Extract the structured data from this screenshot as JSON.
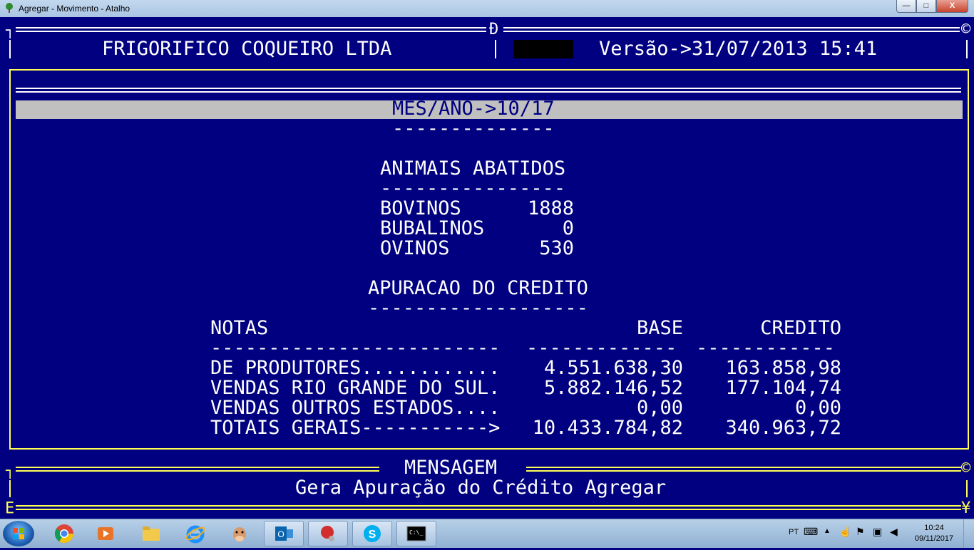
{
  "window": {
    "title": "Agregar - Movimento - Atalho",
    "buttons": [
      "—",
      "□",
      "X"
    ]
  },
  "header": {
    "company": "FRIGORIFICO COQUEIRO LTDA",
    "version": "Versão->31/07/2013 15:41",
    "corner_mark": "Ð"
  },
  "report": {
    "period": "MES/ANO->10/17",
    "period_underline": "--------------",
    "animals": {
      "title": "ANIMAIS ABATIDOS",
      "underline": "----------------",
      "rows": [
        {
          "label": "BOVINOS",
          "value": "1888"
        },
        {
          "label": "BUBALINOS",
          "value": "0"
        },
        {
          "label": "OVINOS",
          "value": "530"
        }
      ]
    },
    "credit": {
      "title": "APURACAO DO CREDITO",
      "underline": "-------------------",
      "columns": [
        "NOTAS",
        "BASE",
        "CREDITO"
      ],
      "dashes": [
        "-------------------------",
        "-------------",
        "------------"
      ],
      "rows": [
        {
          "label": "DE PRODUTORES............",
          "base": "4.551.638,30",
          "credito": "163.858,98"
        },
        {
          "label": "VENDAS RIO GRANDE DO SUL.",
          "base": "5.882.146,52",
          "credito": "177.104,74"
        },
        {
          "label": "VENDAS OUTROS ESTADOS....",
          "base": "0,00",
          "credito": "0,00"
        },
        {
          "label": "TOTAIS GERAIS----------->",
          "base": "10.433.784,82",
          "credito": "340.963,72"
        }
      ]
    }
  },
  "message": {
    "title": "MENSAGEM",
    "text": "Gera Apuração do Crédito Agregar"
  },
  "frame_glyphs": {
    "tl": "┐",
    "tr": "©",
    "ml": "┐",
    "mr": "©",
    "bl": "Ε",
    "br": "¥"
  },
  "taskbar": {
    "apps": [
      "chrome-icon",
      "media-player-icon",
      "file-explorer-icon",
      "internet-explorer-icon",
      "cow-app-icon",
      "outlook-icon",
      "app-red-icon",
      "skype-icon",
      "command-prompt-icon"
    ],
    "language": "PT",
    "time": "10:24",
    "date": "09/11/2017",
    "cmd_label": "C:\\_"
  },
  "colors": {
    "console_bg": "#000080",
    "frame": "#ffff55",
    "text": "#ffffff",
    "highlight_band": "#c0c0c0"
  }
}
